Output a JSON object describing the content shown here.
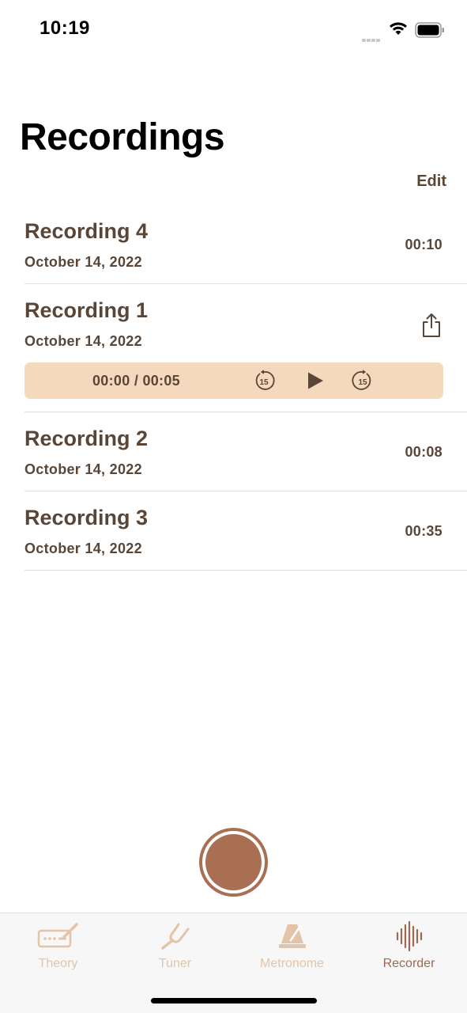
{
  "status_bar": {
    "time": "10:19"
  },
  "header": {
    "title": "Recordings",
    "edit_label": "Edit"
  },
  "recordings": [
    {
      "name": "Recording 4",
      "date": "October 14, 2022",
      "duration": "00:10"
    },
    {
      "name": "Recording 1",
      "date": "October 14, 2022",
      "player_time": "00:00 / 00:05",
      "skip_back_label": "15",
      "skip_forward_label": "15"
    },
    {
      "name": "Recording 2",
      "date": "October 14, 2022",
      "duration": "00:08"
    },
    {
      "name": "Recording 3",
      "date": "October 14, 2022",
      "duration": "00:35"
    }
  ],
  "tabs": [
    {
      "label": "Theory",
      "icon": "keyboard-pencil-icon",
      "active": false
    },
    {
      "label": "Tuner",
      "icon": "tuning-fork-icon",
      "active": false
    },
    {
      "label": "Metronome",
      "icon": "metronome-icon",
      "active": false
    },
    {
      "label": "Recorder",
      "icon": "waveform-icon",
      "active": true
    }
  ],
  "colors": {
    "accent": "#a86f52",
    "text": "#5a4637",
    "player_bg": "#f5d9bd",
    "inactive_tab": "#e3c4a8",
    "active_tab": "#9a6a52"
  }
}
